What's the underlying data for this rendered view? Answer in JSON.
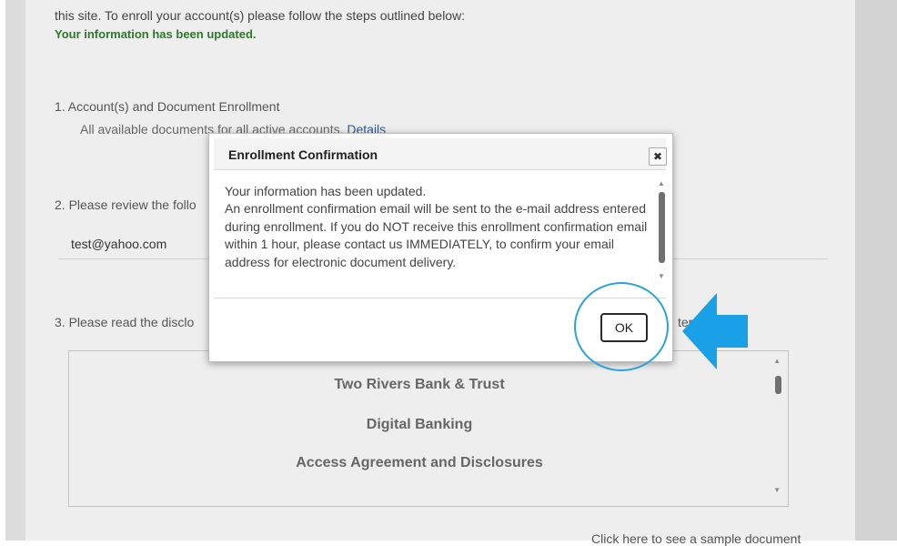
{
  "page": {
    "intro_text": "this site. To enroll your account(s) please follow the steps outlined below:",
    "updated_message": "Your information has been updated.",
    "step1": {
      "label": "1. Account(s) and Document Enrollment",
      "sub_text": "All available documents for all active accounts.",
      "details_link": "Details"
    },
    "step2": {
      "label": "2. Please review the follo",
      "email_value": "test@yahoo.com"
    },
    "step3": {
      "label": "3. Please read the disclo",
      "label_tail": "terms listed."
    },
    "disclosure": {
      "line1": "Two Rivers Bank & Trust",
      "line2": "Digital Banking",
      "line3": "Access Agreement and Disclosures"
    },
    "sample_link": "Click here to see a sample document"
  },
  "modal": {
    "title": "Enrollment Confirmation",
    "close_glyph": "✖",
    "line1": "Your information has been updated.",
    "line2": "An enrollment confirmation email will be sent to the e-mail address entered during enrollment. If you do NOT receive this enrollment confirmation email within 1 hour, please contact us IMMEDIATELY, to confirm your email address for electronic document delivery.",
    "ok_label": "OK"
  },
  "colors": {
    "success_text": "#2a7a2a",
    "highlight": "#29a3df",
    "arrow": "#19a0e6"
  },
  "icons": {
    "close": "close-icon",
    "arrow": "arrow-left-icon",
    "scroll_up": "triangle-up",
    "scroll_down": "triangle-down"
  }
}
